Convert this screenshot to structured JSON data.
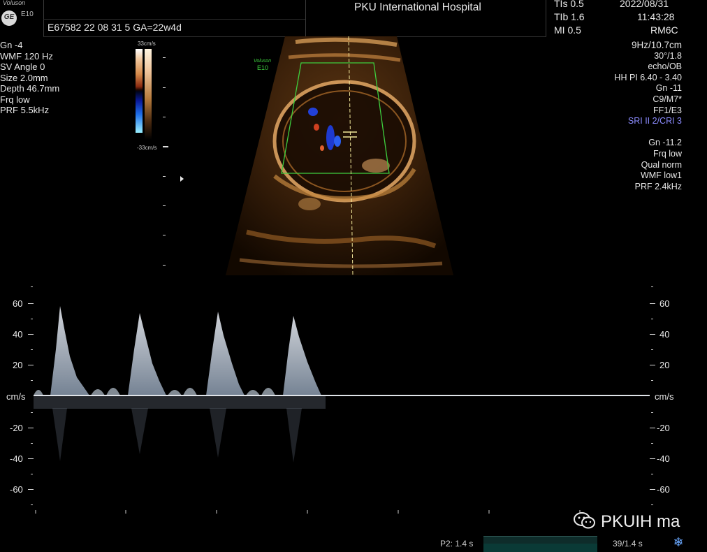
{
  "header": {
    "brand": "Voluson",
    "model": "E10",
    "logo_text": "GE",
    "patient_line": "E67582 22 08 31 5  GA=22w4d",
    "hospital": "PKU International Hospital",
    "tis": "TIs  0.5",
    "tib": "TIb  1.6",
    "mi": "MI  0.5",
    "date": "2022/08/31",
    "time": "11:43:28",
    "probe": "RM6C"
  },
  "left_params": [
    "Gn -4",
    "WMF 120 Hz",
    "SV Angle  0",
    "Size  2.0mm",
    "Depth 46.7mm",
    "Frq low",
    "PRF  5.5kHz"
  ],
  "colorbar": {
    "top_label": "33cm/s",
    "bottom_label": "-33cm/s"
  },
  "image_watermark": {
    "line1": "Voluson",
    "line2": "E10"
  },
  "right_params": {
    "block1": [
      "9Hz/10.7cm",
      "30°/1.8",
      "echo/OB",
      "HH PI 6.40 - 3.40",
      "Gn -11",
      "C9/M7*",
      "FF1/E3"
    ],
    "sri": "SRI II 2/CRI 3",
    "block2": [
      "Gn -11.2",
      "Frq low",
      "Qual norm",
      "WMF low1",
      "PRF  2.4kHz"
    ]
  },
  "doppler": {
    "unit": "cm/s",
    "labels_left": [
      "60",
      "40",
      "20",
      "-20",
      "-40",
      "-60"
    ],
    "labels_right": [
      "60",
      "40",
      "20",
      "-20",
      "-40",
      "-60"
    ]
  },
  "footer": {
    "watermark": "PKUIH ma",
    "p2": "P2: 1.4 s",
    "frames": "39/1.4 s"
  },
  "colors": {
    "background": "#000000",
    "roi_box": "#3ecf3e",
    "sri_text": "#8c8cff",
    "spectrum": "#c8d4e0"
  }
}
